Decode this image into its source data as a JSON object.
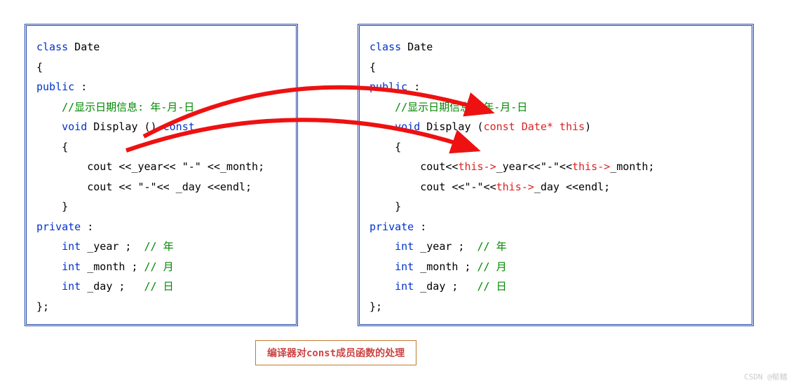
{
  "left": {
    "l1_kw": "class",
    "l1_txt": " Date",
    "l2": "{",
    "l3_kw": "public",
    "l3_txt": " :",
    "l4_cm": "//显示日期信息: 年-月-日",
    "l5_kw": "void",
    "l5_txt": " Display () ",
    "l5_kw2": "const",
    "l6": "{",
    "l7": "cout <<_year<< \"-\" <<_month;",
    "l8": "cout << \"-\"<< _day <<endl;",
    "l9": "}",
    "l10_kw": "private",
    "l10_txt": " :",
    "l11_kw": "int",
    "l11_txt": " _year ;  ",
    "l11_cm": "// 年",
    "l12_kw": "int",
    "l12_txt": " _month ; ",
    "l12_cm": "// 月",
    "l13_kw": "int",
    "l13_txt": " _day ;   ",
    "l13_cm": "// 日",
    "l14": "};"
  },
  "right": {
    "l1_kw": "class",
    "l1_txt": " Date",
    "l2": "{",
    "l3_kw": "public",
    "l3_txt": " :",
    "l4_cm": "//显示日期信息: 年-月-日",
    "l5_kw": "void",
    "l5_txt": " Display (",
    "l5_hl": "const Date* this",
    "l5_txt2": ")",
    "l6": "{",
    "l7_a": "cout<<",
    "l7_hl1": "this->",
    "l7_b": "_year<<\"-\"<<",
    "l7_hl2": "this->",
    "l7_c": "_month;",
    "l8_a": "cout <<\"-\"<<",
    "l8_hl": "this->",
    "l8_b": "_day <<endl;",
    "l9": "}",
    "l10_kw": "private",
    "l10_txt": " :",
    "l11_kw": "int",
    "l11_txt": " _year ;  ",
    "l11_cm": "// 年",
    "l12_kw": "int",
    "l12_txt": " _month ; ",
    "l12_cm": "// 月",
    "l13_kw": "int",
    "l13_txt": " _day ;   ",
    "l13_cm": "// 日",
    "l14": "};"
  },
  "caption": "编译器对const成员函数的处理",
  "watermark": "CSDN @郁鳍"
}
